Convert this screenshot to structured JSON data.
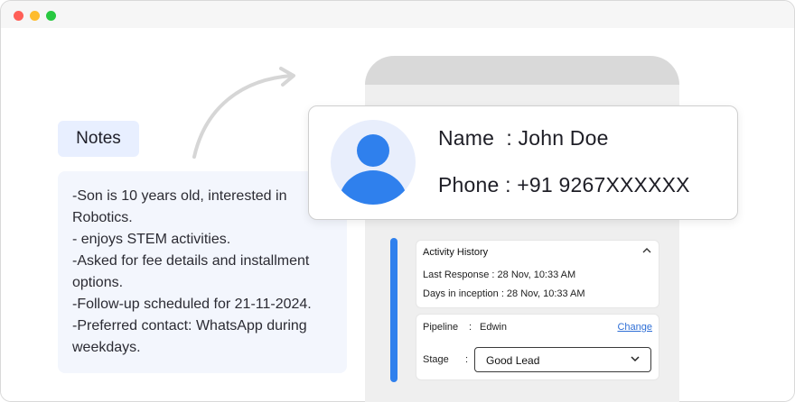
{
  "notes": {
    "badge": "Notes",
    "lines": [
      "-Son is 10 years old, interested in",
      "Robotics.",
      "- enjoys STEM activities.",
      "-Asked for fee details and installment",
      "options.",
      "-Follow-up scheduled for 21-11-2024.",
      "-Preferred contact: WhatsApp during",
      "weekdays."
    ]
  },
  "profile": {
    "name_label": "Name  : John Doe",
    "phone_label": "Phone : +91 9267XXXXXX"
  },
  "activity": {
    "title": "Activity History",
    "last_response": "Last Response  :  28 Nov, 10:33 AM",
    "days_in_inception": "Days in inception  :  28 Nov, 10:33 AM"
  },
  "pipeline": {
    "label": "Pipeline",
    "sep": ":",
    "value": "Edwin",
    "change": "Change",
    "stage_label": "Stage",
    "stage_sep": ":",
    "stage_value": "Good Lead"
  },
  "colors": {
    "accent": "#2f80ed",
    "avatar_fill": "#2f80ed",
    "avatar_bg": "#e8eefc",
    "notes_bg": "#f3f6fd"
  }
}
